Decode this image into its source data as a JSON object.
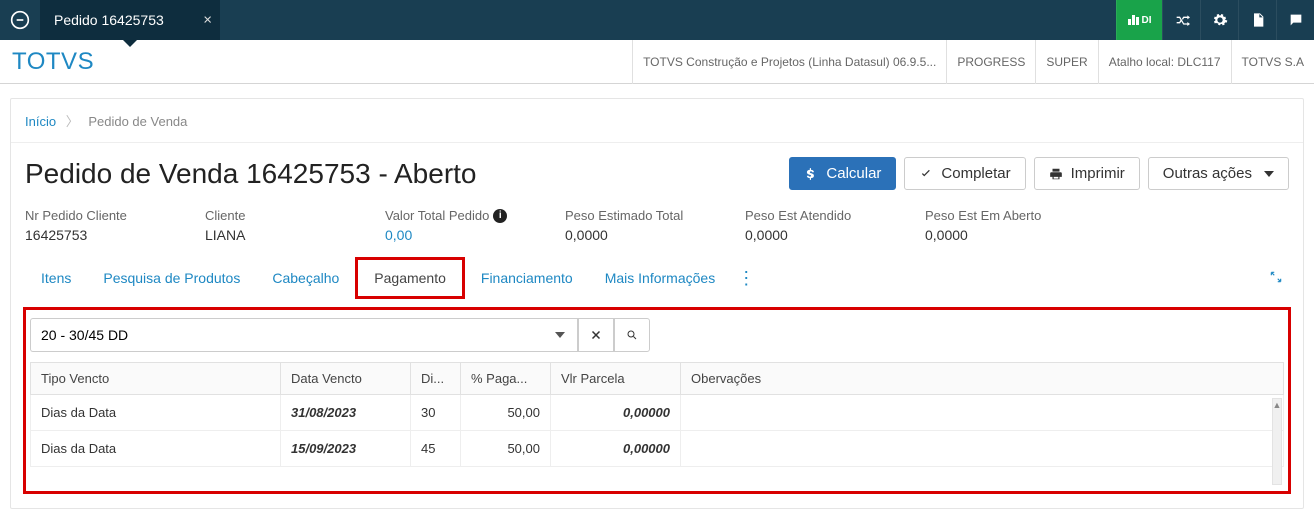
{
  "topbar": {
    "tab_title": "Pedido 16425753",
    "di_label": "DI"
  },
  "brandbar": {
    "brand": "TOTVS",
    "crumbs": [
      "TOTVS Construção e Projetos (Linha Datasul) 06.9.5...",
      "PROGRESS",
      "SUPER",
      "Atalho local: DLC117",
      "TOTVS S.A"
    ]
  },
  "breadcrumb": {
    "home": "Início",
    "current": "Pedido de Venda"
  },
  "page_title": "Pedido de Venda 16425753 - Aberto",
  "actions": {
    "calcular": "Calcular",
    "completar": "Completar",
    "imprimir": "Imprimir",
    "outras": "Outras ações"
  },
  "summary": {
    "nr_pedido_lbl": "Nr Pedido Cliente",
    "nr_pedido_val": "16425753",
    "cliente_lbl": "Cliente",
    "cliente_val": "LIANA",
    "valor_lbl": "Valor Total Pedido",
    "valor_val": "0,00",
    "peso_est_lbl": "Peso Estimado Total",
    "peso_est_val": "0,0000",
    "peso_at_lbl": "Peso Est Atendido",
    "peso_at_val": "0,0000",
    "peso_ab_lbl": "Peso Est Em Aberto",
    "peso_ab_val": "0,0000"
  },
  "tabs": {
    "itens": "Itens",
    "pesquisa": "Pesquisa de Produtos",
    "cabecalho": "Cabeçalho",
    "pagamento": "Pagamento",
    "financiamento": "Financiamento",
    "mais_info": "Mais Informações"
  },
  "payment": {
    "search_value": "20 - 30/45 DD",
    "columns": {
      "tipo": "Tipo Vencto",
      "data": "Data Vencto",
      "di": "Di...",
      "pct": "% Paga...",
      "vlr": "Vlr Parcela",
      "obs": "Obervações"
    },
    "rows": [
      {
        "tipo": "Dias da Data",
        "data": "31/08/2023",
        "di": "30",
        "pct": "50,00",
        "vlr": "0,00000",
        "obs": ""
      },
      {
        "tipo": "Dias da Data",
        "data": "15/09/2023",
        "di": "45",
        "pct": "50,00",
        "vlr": "0,00000",
        "obs": ""
      }
    ]
  }
}
